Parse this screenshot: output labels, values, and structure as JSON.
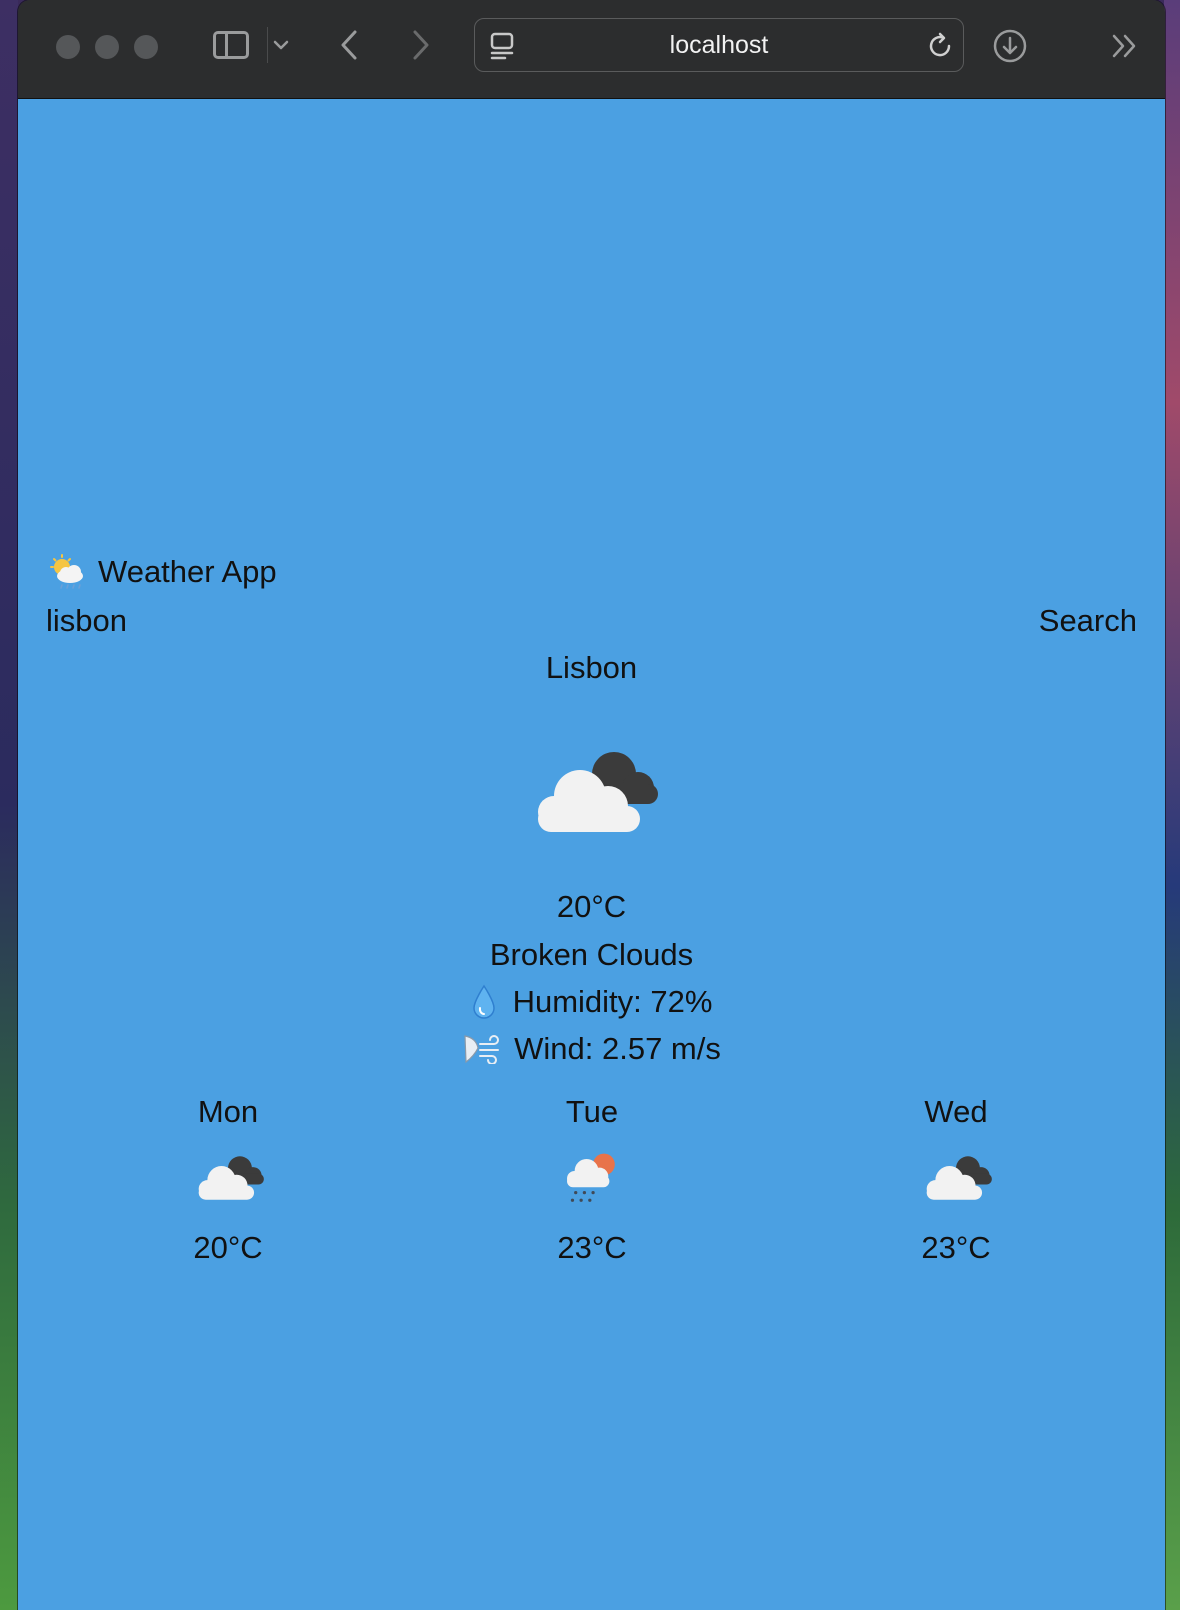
{
  "browser": {
    "url": "localhost"
  },
  "app": {
    "title": "Weather App",
    "search": {
      "input_value": "lisbon",
      "button_label": "Search"
    }
  },
  "current": {
    "city": "Lisbon",
    "icon": "broken-clouds-icon",
    "temperature": "20°C",
    "description": "Broken Clouds",
    "humidity": "Humidity: 72%",
    "wind": "Wind: 2.57 m/s"
  },
  "forecast": [
    {
      "day": "Mon",
      "icon": "broken-clouds-icon",
      "temp": "20°C"
    },
    {
      "day": "Tue",
      "icon": "rain-sun-icon",
      "temp": "23°C"
    },
    {
      "day": "Wed",
      "icon": "broken-clouds-icon",
      "temp": "23°C"
    }
  ],
  "colors": {
    "background": "#4ba0e2",
    "toolbar": "#2c2d2e"
  }
}
